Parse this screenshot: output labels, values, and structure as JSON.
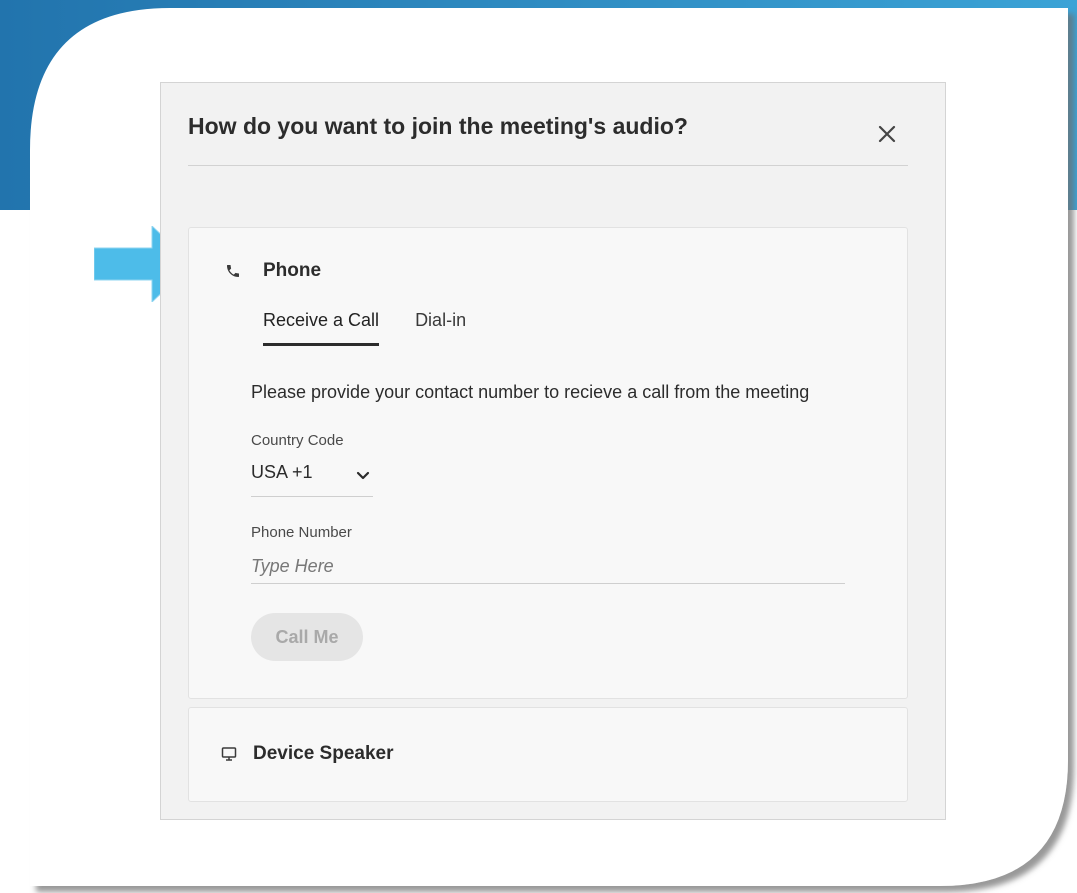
{
  "dialog": {
    "title": "How do you want to join the meeting's audio?",
    "close_icon": "close-icon"
  },
  "phone_section": {
    "label": "Phone",
    "icon": "phone-icon",
    "tabs": [
      {
        "label": "Receive a Call",
        "active": true
      },
      {
        "label": "Dial-in",
        "active": false
      }
    ],
    "instructions": "Please provide your contact number to recieve a call from the meeting",
    "country_code": {
      "label": "Country Code",
      "value": "USA +1"
    },
    "phone_number": {
      "label": "Phone Number",
      "placeholder": "Type Here",
      "value": ""
    },
    "call_button": "Call Me"
  },
  "speaker_section": {
    "label": "Device Speaker",
    "icon": "monitor-icon"
  },
  "colors": {
    "frame_blue": "#2a7fb8",
    "arrow_blue": "#4dbce9",
    "dialog_bg": "#f2f2f2",
    "panel_bg": "#f8f8f8",
    "disabled_button_bg": "#e5e5e5",
    "disabled_button_text": "#a9a9a9"
  }
}
